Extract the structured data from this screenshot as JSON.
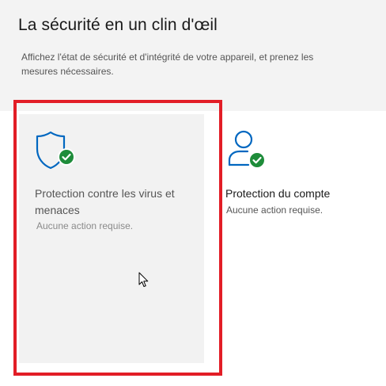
{
  "header": {
    "title": "La sécurité en un clin d'œil",
    "description": "Affichez l'état de sécurité et d'intégrité de votre appareil, et prenez les mesures nécessaires."
  },
  "cards": [
    {
      "title": "Protection contre les virus et menaces",
      "status": "Aucune action requise.",
      "icon": "shield-check-icon",
      "selected": true
    },
    {
      "title": "Protection du compte",
      "status": "Aucune action requise.",
      "icon": "person-check-icon",
      "selected": false
    }
  ],
  "colors": {
    "accent": "#0067c0",
    "status_ok": "#1e8c3a",
    "highlight": "#e21d26"
  }
}
